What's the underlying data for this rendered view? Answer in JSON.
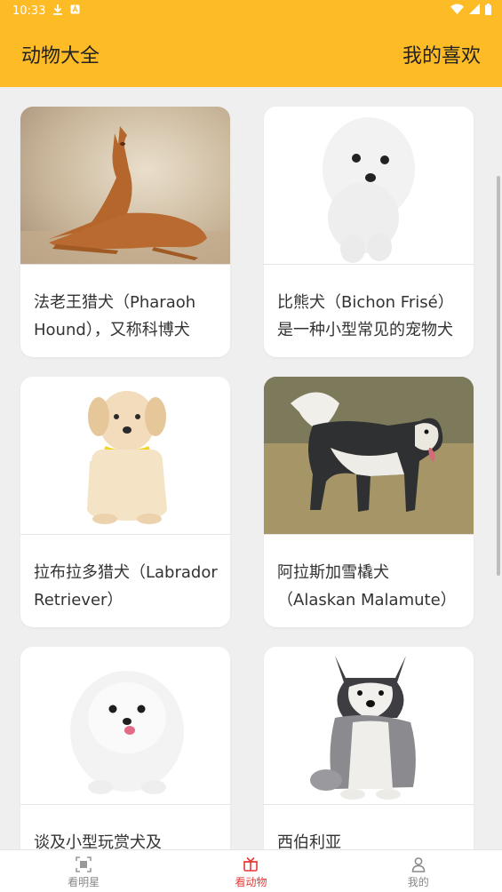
{
  "status_bar": {
    "time": "10:33",
    "icons": [
      "download-icon",
      "notification-a-icon",
      "wifi-icon",
      "signal-icon",
      "battery-icon"
    ]
  },
  "app_bar": {
    "title": "动物大全",
    "favorites_label": "我的喜欢",
    "color": "#fdbb26"
  },
  "cards": [
    {
      "caption": "法老王猎犬（Pharaoh Hound），又称科博犬",
      "image": "pharaoh-hound-photo"
    },
    {
      "caption": "比熊犬（Bichon Frisé）是一种小型常见的宠物犬",
      "image": "bichon-frise-photo"
    },
    {
      "caption": "拉布拉多猎犬（Labrador Retriever）",
      "image": "labrador-puppy-photo"
    },
    {
      "caption": "阿拉斯加雪橇犬（Alaskan Malamute）",
      "image": "alaskan-malamute-photo"
    },
    {
      "caption": "谈及小型玩赏犬及",
      "image": "pomeranian-photo"
    },
    {
      "caption": "西伯利亚",
      "image": "siberian-husky-puppy-photo"
    }
  ],
  "bottom_nav": {
    "items": [
      {
        "label": "看明星",
        "icon": "scan-icon",
        "active": false
      },
      {
        "label": "看动物",
        "icon": "gift-box-icon",
        "active": true
      },
      {
        "label": "我的",
        "icon": "person-icon",
        "active": false
      }
    ],
    "active_color": "#e53935"
  }
}
